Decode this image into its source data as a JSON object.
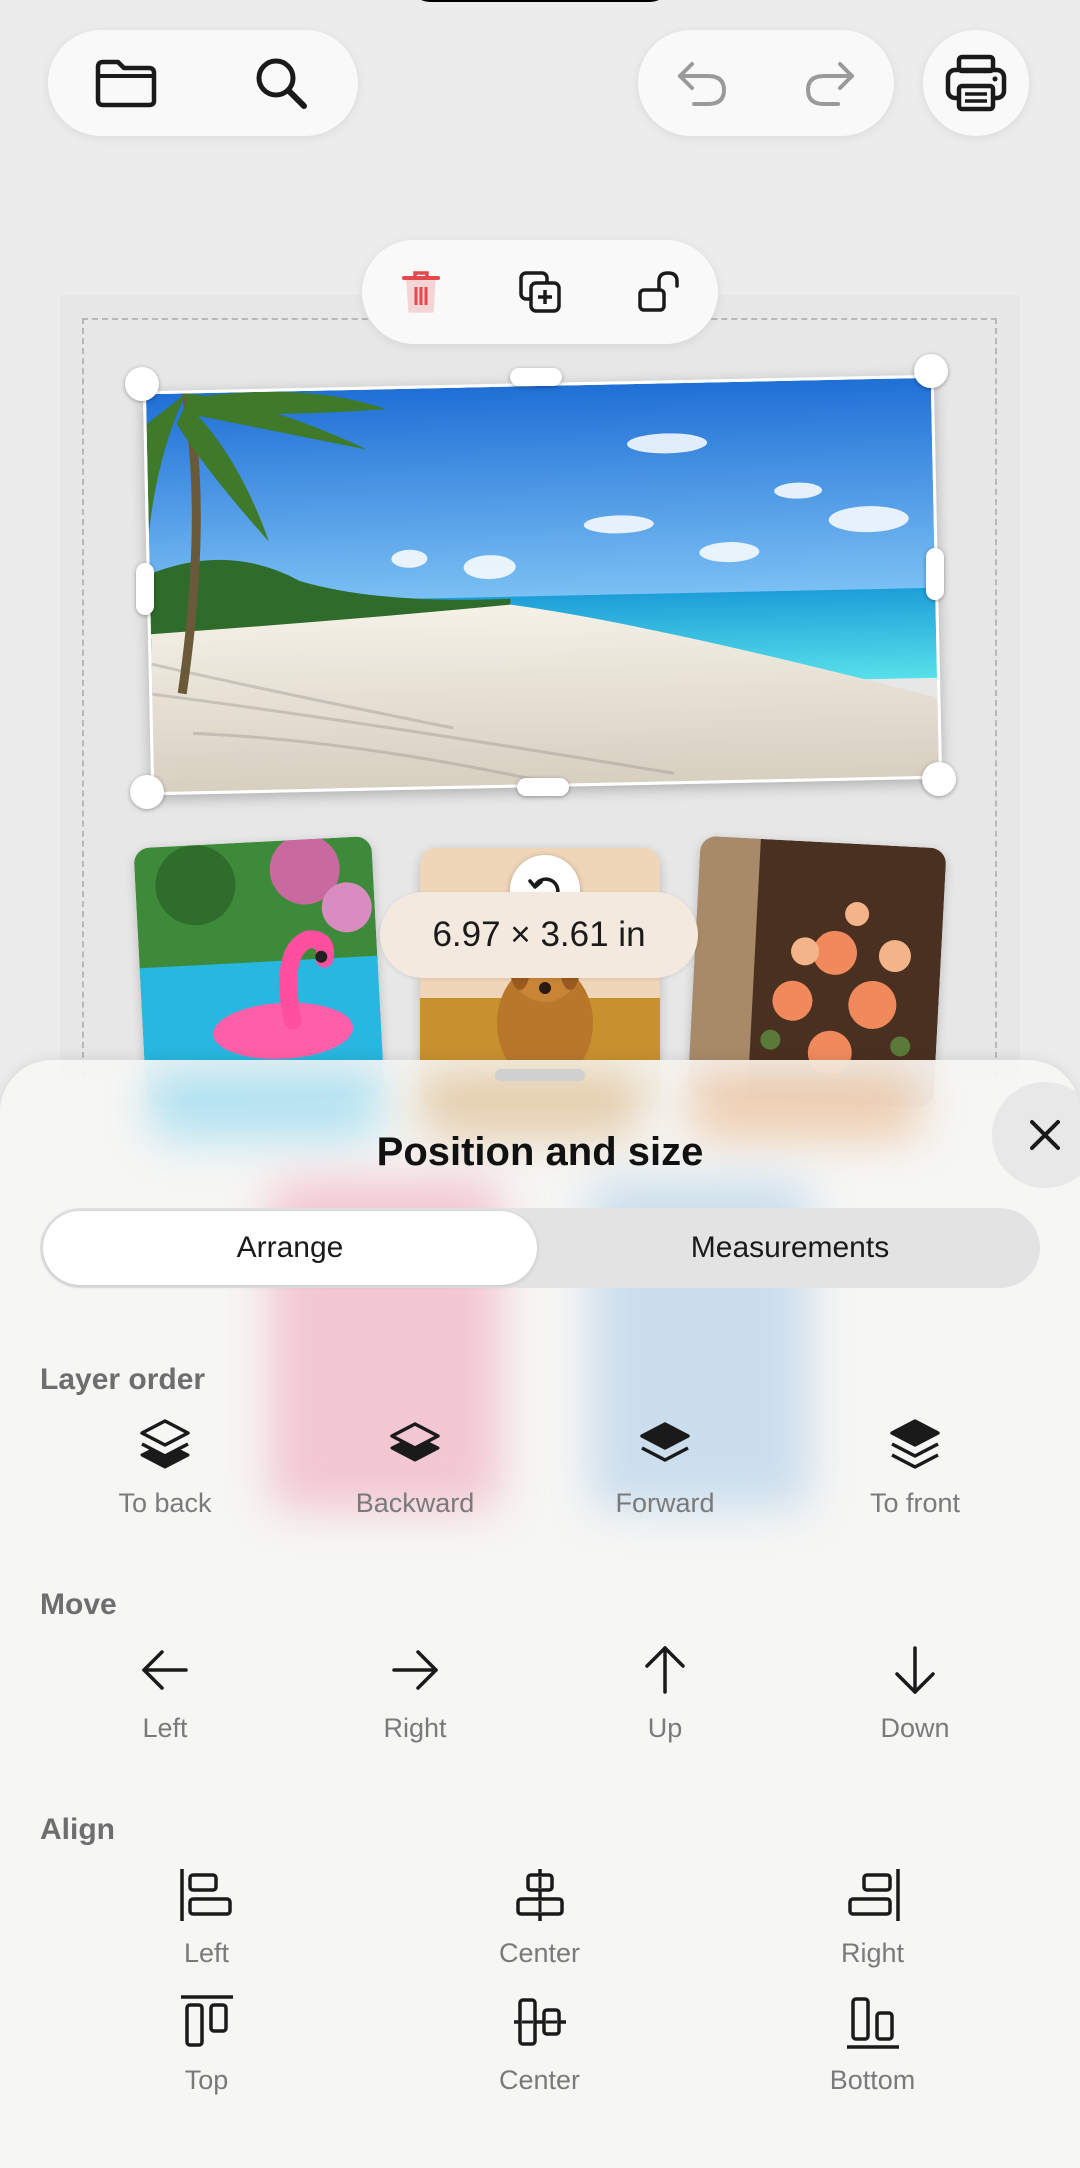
{
  "toolbar": {
    "left_icons": [
      "folder-icon",
      "search-icon"
    ],
    "history_icons": [
      "undo-icon",
      "redo-icon"
    ],
    "print_icon": "printer-icon"
  },
  "context_menu": {
    "icons": [
      "trash-icon",
      "duplicate-icon",
      "unlock-icon"
    ],
    "delete_color": "#e5484d"
  },
  "canvas": {
    "selected_image": "beach-photo",
    "thumbnails": [
      "flamingo-pool-photo",
      "golden-retriever-photo",
      "flower-bouquet-photo"
    ],
    "size_label": "6.97 × 3.61 in"
  },
  "sheet": {
    "title": "Position and size",
    "tabs": [
      {
        "label": "Arrange",
        "active": true
      },
      {
        "label": "Measurements",
        "active": false
      }
    ],
    "layer_order": {
      "title": "Layer order",
      "items": [
        {
          "label": "To back",
          "icon": "layers-to-back-icon"
        },
        {
          "label": "Backward",
          "icon": "layers-backward-icon"
        },
        {
          "label": "Forward",
          "icon": "layers-forward-icon"
        },
        {
          "label": "To front",
          "icon": "layers-to-front-icon"
        }
      ]
    },
    "move": {
      "title": "Move",
      "items": [
        {
          "label": "Left",
          "icon": "arrow-left-icon"
        },
        {
          "label": "Right",
          "icon": "arrow-right-icon"
        },
        {
          "label": "Up",
          "icon": "arrow-up-icon"
        },
        {
          "label": "Down",
          "icon": "arrow-down-icon"
        }
      ]
    },
    "align": {
      "title": "Align",
      "items": [
        {
          "label": "Left",
          "icon": "align-left-icon"
        },
        {
          "label": "Center",
          "icon": "align-center-horizontal-icon"
        },
        {
          "label": "Right",
          "icon": "align-right-icon"
        },
        {
          "label": "Top",
          "icon": "align-top-icon"
        },
        {
          "label": "Center",
          "icon": "align-center-vertical-icon"
        },
        {
          "label": "Bottom",
          "icon": "align-bottom-icon"
        }
      ]
    }
  }
}
